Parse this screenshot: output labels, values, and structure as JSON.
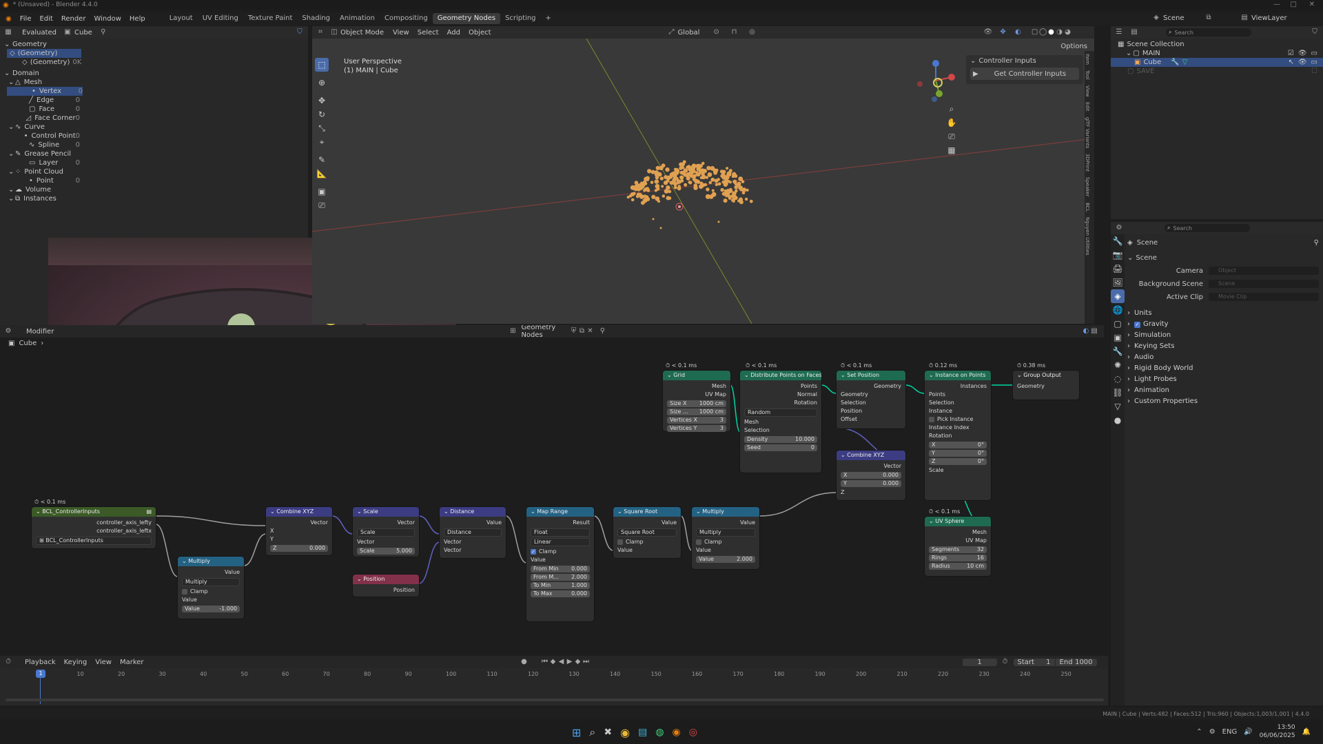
{
  "window": {
    "title": "* (Unsaved) - Blender 4.4.0"
  },
  "menu": [
    "File",
    "Edit",
    "Render",
    "Window",
    "Help"
  ],
  "workspaces": [
    {
      "label": "Layout"
    },
    {
      "label": "UV Editing"
    },
    {
      "label": "Texture Paint"
    },
    {
      "label": "Shading"
    },
    {
      "label": "Animation"
    },
    {
      "label": "Compositing"
    },
    {
      "label": "Geometry Nodes"
    },
    {
      "label": "Scripting"
    },
    {
      "label": "+"
    }
  ],
  "active_workspace": "Geometry Nodes",
  "spreadsheet": {
    "mode": "Evaluated",
    "object": "Cube",
    "section_geometry": "Geometry",
    "geom_items": [
      {
        "label": "(Geometry)"
      },
      {
        "label": "(Geometry)",
        "count": "0K"
      }
    ],
    "section_domain": "Domain",
    "tree": [
      {
        "label": "Mesh",
        "level": 0,
        "count": ""
      },
      {
        "label": "Vertex",
        "level": 1,
        "count": "0",
        "active": true
      },
      {
        "label": "Edge",
        "level": 1,
        "count": "0"
      },
      {
        "label": "Face",
        "level": 1,
        "count": "0"
      },
      {
        "label": "Face Corner",
        "level": 1,
        "count": "0"
      },
      {
        "label": "Curve",
        "level": 0,
        "count": ""
      },
      {
        "label": "Control Point",
        "level": 1,
        "count": "0"
      },
      {
        "label": "Spline",
        "level": 1,
        "count": "0"
      },
      {
        "label": "Grease Pencil",
        "level": 0,
        "count": ""
      },
      {
        "label": "Layer",
        "level": 1,
        "count": "0"
      },
      {
        "label": "Point Cloud",
        "level": 0,
        "count": ""
      },
      {
        "label": "Point",
        "level": 1,
        "count": "0"
      },
      {
        "label": "Volume",
        "level": 0,
        "count": ""
      },
      {
        "label": "Instances",
        "level": 0,
        "count": ""
      }
    ]
  },
  "viewport": {
    "mode": "Object Mode",
    "menus": [
      "View",
      "Select",
      "Add",
      "Object"
    ],
    "transform": "Global",
    "perspective": "User Perspective",
    "collection": "(1) MAIN | Cube",
    "options": "Options",
    "panel_header": "Controller Inputs",
    "panel_button": "Get Controller Inputs",
    "side_tabs": [
      "Item",
      "Tool",
      "View",
      "Edit",
      "glTF Variants",
      "3DPrint",
      "Speaker",
      "BCL",
      "Nguyen Utilities"
    ]
  },
  "outliner": {
    "search_placeholder": "Search",
    "root": "Scene Collection",
    "items": [
      {
        "label": "MAIN",
        "level": 1
      },
      {
        "label": "Cube",
        "level": 2,
        "selected": true
      },
      {
        "label": "SAVE",
        "level": 1,
        "dim": true
      }
    ],
    "scene": "Scene",
    "view_layer": "ViewLayer"
  },
  "properties": {
    "search_placeholder": "Search",
    "context": "Scene",
    "panel": "Scene",
    "fields": [
      {
        "label": "Camera",
        "value": "Object"
      },
      {
        "label": "Background Scene",
        "value": "Scene"
      },
      {
        "label": "Active Clip",
        "value": "Movie Clip"
      }
    ],
    "sections": [
      {
        "label": "Units"
      },
      {
        "label": "Gravity",
        "checked": true
      },
      {
        "label": "Simulation"
      },
      {
        "label": "Keying Sets"
      },
      {
        "label": "Audio"
      },
      {
        "label": "Rigid Body World"
      },
      {
        "label": "Light Probes"
      },
      {
        "label": "Animation"
      },
      {
        "label": "Custom Properties"
      }
    ]
  },
  "node_editor": {
    "tree_name": "Geometry Nodes",
    "modifier_label": "Modifier",
    "object": "Cube",
    "nodes": {
      "grid": {
        "timing": "< 0.1 ms",
        "title": "Grid",
        "outs": [
          "Mesh",
          "UV Map"
        ],
        "fields": [
          [
            "Size X",
            "1000 cm"
          ],
          [
            "Size ...",
            "1000 cm"
          ],
          [
            "Vertices X",
            "3"
          ],
          [
            "Vertices Y",
            "3"
          ]
        ]
      },
      "distribute": {
        "timing": "< 0.1 ms",
        "title": "Distribute Points on Faces",
        "outs": [
          "Points",
          "Normal",
          "Rotation"
        ],
        "mode": "Random",
        "ins": [
          "Mesh",
          "Selection"
        ],
        "fields": [
          [
            "Density",
            "10.000"
          ],
          [
            "Seed",
            "0"
          ]
        ]
      },
      "setpos": {
        "timing": "< 0.1 ms",
        "title": "Set Position",
        "outs": [
          "Geometry"
        ],
        "ins": [
          "Geometry",
          "Selection",
          "Position",
          "Offset"
        ]
      },
      "combine2": {
        "title": "Combine XYZ",
        "outs": [
          "Vector"
        ],
        "fields": [
          [
            "X",
            "0.000"
          ],
          [
            "Y",
            "0.000"
          ]
        ],
        "ins": [
          "Z"
        ]
      },
      "instance": {
        "timing": "0.12 ms",
        "title": "Instance on Points",
        "outs": [
          "Instances"
        ],
        "ins": [
          "Points",
          "Selection",
          "Instance"
        ],
        "pick": "Pick Instance",
        "ins2": [
          "Instance Index",
          "Rotation"
        ],
        "rot": [
          [
            "X",
            "0°"
          ],
          [
            "Y",
            "0°"
          ],
          [
            "Z",
            "0°"
          ]
        ],
        "scale": "Scale"
      },
      "output": {
        "timing": "0.38 ms",
        "title": "Group Output",
        "ins": [
          "Geometry"
        ]
      },
      "uvsphere": {
        "timing": "< 0.1 ms",
        "title": "UV Sphere",
        "outs": [
          "Mesh",
          "UV Map"
        ],
        "fields": [
          [
            "Segments",
            "32"
          ],
          [
            "Rings",
            "16"
          ],
          [
            "Radius",
            "10 cm"
          ]
        ]
      },
      "bcl": {
        "timing": "< 0.1 ms",
        "title": "BCL_ControllerInputs",
        "outs": [
          "controller_axis_lefty",
          "controller_axis_leftx"
        ],
        "group": "BCL_ControllerInputs"
      },
      "multiply1": {
        "title": "Multiply",
        "outs": [
          "Value"
        ],
        "op": "Multiply",
        "clamp": "Clamp",
        "ins": [
          "Value"
        ],
        "fields": [
          [
            "Value",
            "-1.000"
          ]
        ]
      },
      "combine1": {
        "title": "Combine XYZ",
        "outs": [
          "Vector"
        ],
        "ins": [
          "X",
          "Y"
        ],
        "fields": [
          [
            "Z",
            "0.000"
          ]
        ]
      },
      "scale": {
        "title": "Scale",
        "outs": [
          "Vector"
        ],
        "op": "Scale",
        "ins": [
          "Vector"
        ],
        "fields": [
          [
            "Scale",
            "5.000"
          ]
        ]
      },
      "position": {
        "title": "Position",
        "outs": [
          "Position"
        ]
      },
      "distance": {
        "title": "Distance",
        "outs": [
          "Value"
        ],
        "op": "Distance",
        "ins": [
          "Vector",
          "Vector"
        ]
      },
      "maprange": {
        "title": "Map Range",
        "outs": [
          "Result"
        ],
        "type": "Float",
        "interp": "Linear",
        "clamp": "Clamp",
        "ins": [
          "Value"
        ],
        "fields": [
          [
            "From Min",
            "0.000"
          ],
          [
            "From M...",
            "2.000"
          ],
          [
            "To Min",
            "1.000"
          ],
          [
            "To Max",
            "0.000"
          ]
        ]
      },
      "sqrt": {
        "title": "Square Root",
        "outs": [
          "Value"
        ],
        "op": "Square Root",
        "clamp": "Clamp",
        "ins": [
          "Value"
        ]
      },
      "multiply2": {
        "title": "Multiply",
        "outs": [
          "Value"
        ],
        "op": "Multiply",
        "clamp": "Clamp",
        "ins": [
          "Value"
        ],
        "fields": [
          [
            "Value",
            "2.000"
          ]
        ]
      }
    }
  },
  "timeline": {
    "menus": [
      "Playback",
      "Keying",
      "View",
      "Marker"
    ],
    "current": "1",
    "start_label": "Start",
    "start": "1",
    "end_label": "End",
    "end": "1000",
    "ticks": [
      "1",
      "10",
      "20",
      "30",
      "40",
      "50",
      "60",
      "70",
      "80",
      "90",
      "100",
      "110",
      "120",
      "130",
      "140",
      "150",
      "160",
      "170",
      "180",
      "190",
      "200",
      "210",
      "220",
      "230",
      "240",
      "250"
    ]
  },
  "status": {
    "text": "MAIN | Cube | Verts:482 | Faces:512 | Tris:960 | Objects:1,003/1,001 | 4.4.0"
  },
  "taskbar": {
    "lang": "ENG",
    "time": "13:50",
    "date": "06/06/2025"
  },
  "colors": {
    "accent": "#4a6caa",
    "geometry_node": "#1f6b51",
    "vector_node": "#3c3c83",
    "math_node": "#246283",
    "input_node": "#83314a",
    "group_node": "#3b5a27",
    "points": "#e0a152"
  }
}
